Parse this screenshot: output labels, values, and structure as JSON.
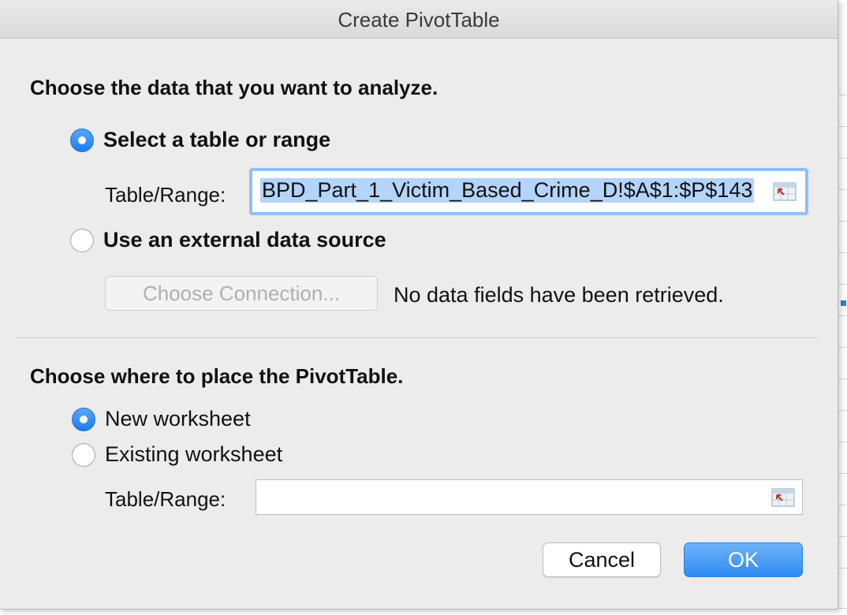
{
  "dialog": {
    "title": "Create PivotTable"
  },
  "source_section": {
    "heading": "Choose the data that you want to analyze.",
    "option_range_label": "Select a table or range",
    "option_range_selected": true,
    "range_field_label": "Table/Range:",
    "range_field_value": "BPD_Part_1_Victim_Based_Crime_D!$A$1:$P$143",
    "option_external_label": "Use an external data source",
    "option_external_selected": false,
    "choose_connection_label": "Choose Connection...",
    "no_fields_text": "No data fields have been retrieved."
  },
  "place_section": {
    "heading": "Choose where to place the PivotTable.",
    "option_new_label": "New worksheet",
    "option_new_selected": true,
    "option_existing_label": "Existing worksheet",
    "option_existing_selected": false,
    "range_field_label": "Table/Range:",
    "range_field_value": ""
  },
  "buttons": {
    "cancel_label": "Cancel",
    "ok_label": "OK"
  },
  "colors": {
    "accent": "#2f8cf4",
    "focus_ring": "#92bff4",
    "selection": "#b3d4fb"
  },
  "icons": {
    "range_picker": "collapse-range-icon"
  }
}
